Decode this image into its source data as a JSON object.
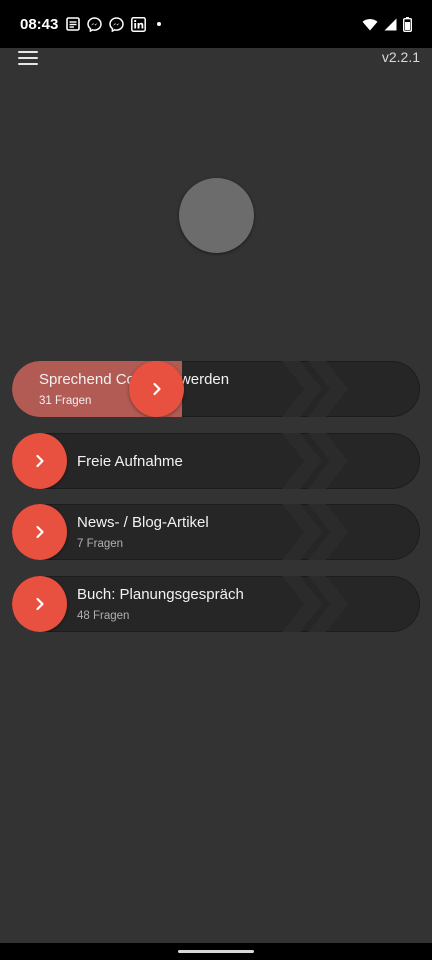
{
  "status_bar": {
    "time": "08:43",
    "left_icons": [
      "notes-icon",
      "messenger-icon",
      "messenger-icon",
      "linkedin-icon",
      "dot-icon"
    ],
    "right_icons": [
      "wifi-icon",
      "signal-icon",
      "battery-icon"
    ]
  },
  "app_bar": {
    "menu_icon": "hamburger-menu-icon",
    "version": "v2.2.1"
  },
  "colors": {
    "accent": "#e8503f",
    "background": "#333333",
    "row_background": "#262626",
    "progress": "#b25a54"
  },
  "list": {
    "items": [
      {
        "title": "Sprechend Co-Autor werden",
        "subtitle": "31 Fragen",
        "active": true,
        "progress": 0.4
      },
      {
        "title": "Freie Aufnahme",
        "subtitle": "",
        "active": false
      },
      {
        "title": "News- / Blog-Artikel",
        "subtitle": "7 Fragen",
        "active": false
      },
      {
        "title": "Buch: Planungsgespräch",
        "subtitle": "48 Fragen",
        "active": false
      }
    ]
  }
}
